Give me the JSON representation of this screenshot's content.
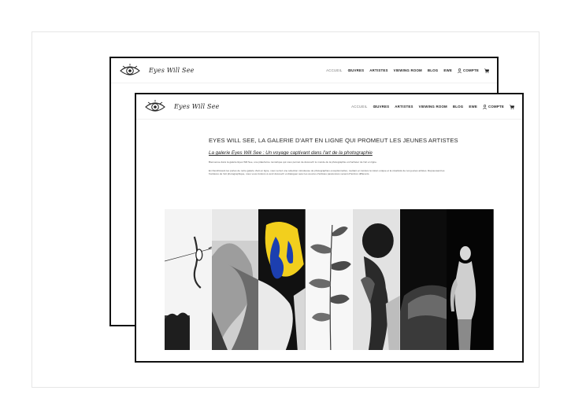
{
  "logo": {
    "text": "Eyes Will See"
  },
  "nav": {
    "items": [
      "ACCUEIL",
      "ŒUVRES",
      "ARTISTES",
      "VIEWING ROOM",
      "BLOG",
      "EWE"
    ],
    "account": "COMPTE"
  },
  "hero": {
    "title": "EYES WILL SEE, LA GALERIE D'ART EN LIGNE QUI PROMEUT LES JEUNES ARTISTES",
    "subtitle": "La galerie Eyes Will See : Un voyage captivant dans l'art de la photographie",
    "paragraph1": "Bienvenue dans la galerie Eyes Will See, une plateforme numérique qui vous permet de découvrir le monde de la photographie et d'acheter de l'art en ligne.",
    "paragraph2": "En franchissant les portes de notre galerie d'art en ligne, vous verrez une sélection minutieuse de photographies exceptionnelles, mettant en lumière la vision unique et la créativité de nos jeunes artistes. Repoussant les frontières de l'art photographique, nous vous invitons à venir découvrir et dialoguer avec les œuvres d'artistes passionnés venant d'horizon différents."
  },
  "colors": {
    "border": "#111111",
    "accent_yellow": "#f2cf1d",
    "accent_blue": "#1c3fb0"
  },
  "icons": [
    "eye-logo-icon",
    "account-icon",
    "cart-icon"
  ]
}
